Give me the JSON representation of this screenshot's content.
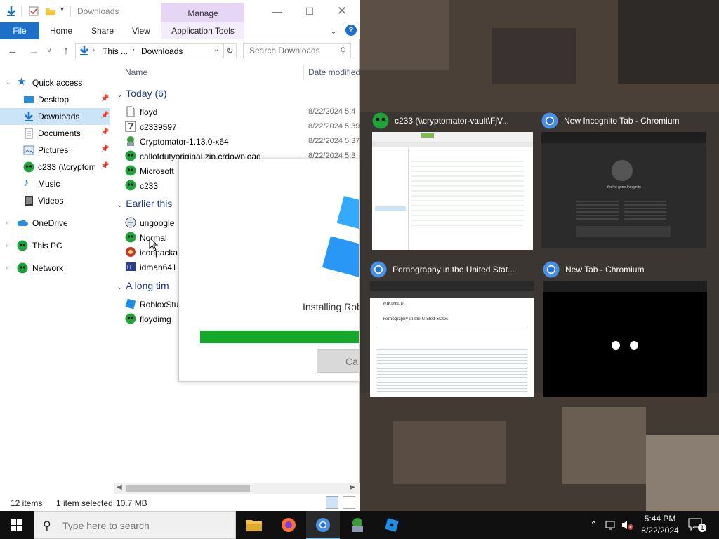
{
  "explorer": {
    "title": "Downloads",
    "manage_tab": "Manage",
    "ribbon_tabs": {
      "file": "File",
      "home": "Home",
      "share": "Share",
      "view": "View",
      "app_tools": "Application Tools"
    },
    "address": {
      "segment1": "This ...",
      "segment2": "Downloads"
    },
    "search": {
      "placeholder": "Search Downloads"
    },
    "nav": {
      "quick_access": "Quick access",
      "items": [
        {
          "label": "Desktop"
        },
        {
          "label": "Downloads"
        },
        {
          "label": "Documents"
        },
        {
          "label": "Pictures"
        },
        {
          "label": "c233 (\\\\cryptom"
        },
        {
          "label": "Music"
        },
        {
          "label": "Videos"
        }
      ],
      "onedrive": "OneDrive",
      "this_pc": "This PC",
      "network": "Network"
    },
    "columns": {
      "name": "Name",
      "date": "Date modified"
    },
    "groups": {
      "today": "Today (6)",
      "earlier": "Earlier this",
      "long_ago": "A long tim"
    },
    "files_today": [
      {
        "name": "floyd",
        "date": "8/22/2024 5:4"
      },
      {
        "name": "c2339597",
        "date": "8/22/2024 5:39"
      },
      {
        "name": "Cryptomator-1.13.0-x64",
        "date": "8/22/2024 5:37"
      },
      {
        "name": "callofdutyoriginal.zip.crdownload",
        "date": "8/22/2024 5:3"
      },
      {
        "name": "Microsoft",
        "date": ""
      },
      {
        "name": "c233",
        "date": ""
      }
    ],
    "files_earlier": [
      {
        "name": "ungoogle"
      },
      {
        "name": "Normal"
      },
      {
        "name": "iconpacka"
      },
      {
        "name": "idman641"
      }
    ],
    "files_long_ago": [
      {
        "name": "RobloxStu"
      },
      {
        "name": "floydimg"
      }
    ],
    "status": {
      "items": "12 items",
      "selected": "1 item selected",
      "size": "10.7 MB"
    }
  },
  "roblox_installer": {
    "status_text": "Installing Rob",
    "cancel_label": "Ca",
    "progress": 1.0
  },
  "task_view": [
    {
      "title": "c233 (\\\\cryptomator-vault\\FjV...",
      "icon": "c233-icon"
    },
    {
      "title": "New Incognito Tab - Chromium",
      "icon": "chromium-icon"
    },
    {
      "title": "Pornography in the United Stat...",
      "icon": "chromium-icon"
    },
    {
      "title": "New Tab - Chromium",
      "icon": "chromium-icon"
    }
  ],
  "thumb_text": {
    "incognito_heading": "You've gone Incognito",
    "wiki_heading": "Pornography in the United States",
    "wiki_brand": "WIKIPEDIA"
  },
  "taskbar": {
    "search_placeholder": "Type here to search",
    "time": "5:44 PM",
    "date": "8/22/2024",
    "notification_count": "1"
  },
  "colors": {
    "accent": "#1e6fc8",
    "manage_tab": "#e5d6f5",
    "selection": "#cce4f7",
    "progress_green": "#16a829",
    "taskbar": "#101010"
  }
}
